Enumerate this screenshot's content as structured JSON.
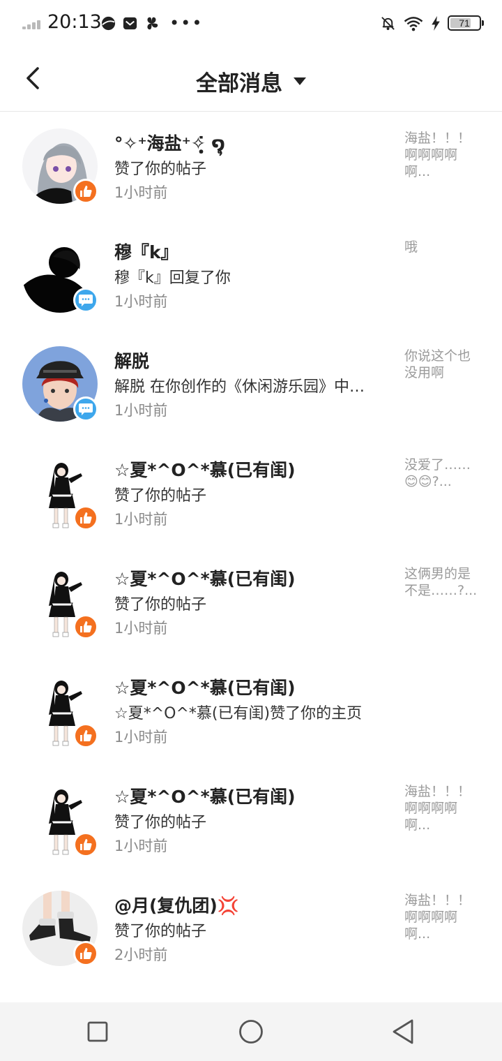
{
  "status_bar": {
    "time": "20:13",
    "battery": "71",
    "icons": [
      "signal-icon",
      "qq-browser-icon",
      "mail-icon",
      "fan-icon",
      "more-dots-icon",
      "mute-bell-icon",
      "wifi-icon",
      "charging-icon",
      "battery-icon"
    ]
  },
  "header": {
    "title": "全部消息",
    "back_icon": "chevron-left-icon",
    "dropdown_icon": "caret-down-icon"
  },
  "messages": [
    {
      "name": "°✧⁺海盐⁺✧̣̥̇ ໑ຸ",
      "action": "赞了你的帖子",
      "time": "1小时前",
      "preview": "海盐！！！啊啊啊啊啊...",
      "type": "like",
      "avatar": "grey-hair-girl"
    },
    {
      "name": "穆『k』",
      "action": "穆『k』回复了你",
      "time": "1小时前",
      "preview": "哦",
      "type": "reply",
      "avatar": "dark-silhouette"
    },
    {
      "name": "解脱",
      "action": "解脱 在你创作的《休闲游乐园》中…",
      "time": "1小时前",
      "preview": "你说这个也没用啊",
      "type": "reply",
      "avatar": "red-hair-cap"
    },
    {
      "name": "☆夏*^O^*慕(已有闺)",
      "action": "赞了你的帖子",
      "time": "1小时前",
      "preview": "没爱了……😊😊?...",
      "type": "like",
      "avatar": "anime-figure"
    },
    {
      "name": "☆夏*^O^*慕(已有闺)",
      "action": "赞了你的帖子",
      "time": "1小时前",
      "preview": "这俩男的是不是……?...",
      "type": "like",
      "avatar": "anime-figure"
    },
    {
      "name": "☆夏*^O^*慕(已有闺)",
      "action": "☆夏*^O^*慕(已有闺)赞了你的主页",
      "time": "1小时前",
      "preview": "",
      "type": "like",
      "avatar": "anime-figure"
    },
    {
      "name": "☆夏*^O^*慕(已有闺)",
      "action": "赞了你的帖子",
      "time": "1小时前",
      "preview": "海盐！！！啊啊啊啊啊...",
      "type": "like",
      "avatar": "anime-figure"
    },
    {
      "name": "@月(复仇团)💢",
      "action": "赞了你的帖子",
      "time": "2小时前",
      "preview": "海盐！！！啊啊啊啊啊...",
      "type": "like",
      "avatar": "sneaker-legs"
    }
  ],
  "nav": {
    "icons": [
      "recent-apps-square-icon",
      "home-circle-icon",
      "back-triangle-icon"
    ]
  },
  "colors": {
    "like_badge": "#f4701f",
    "reply_badge": "#3ea7ec",
    "nav_bg": "#f4f4f4"
  }
}
